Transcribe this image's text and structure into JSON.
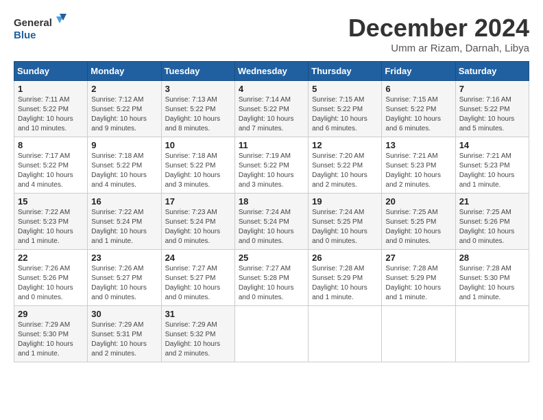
{
  "header": {
    "logo_line1": "General",
    "logo_line2": "Blue",
    "month": "December 2024",
    "location": "Umm ar Rizam, Darnah, Libya"
  },
  "weekdays": [
    "Sunday",
    "Monday",
    "Tuesday",
    "Wednesday",
    "Thursday",
    "Friday",
    "Saturday"
  ],
  "weeks": [
    [
      {
        "day": "1",
        "sunrise": "7:11 AM",
        "sunset": "5:22 PM",
        "daylight": "10 hours and 10 minutes."
      },
      {
        "day": "2",
        "sunrise": "7:12 AM",
        "sunset": "5:22 PM",
        "daylight": "10 hours and 9 minutes."
      },
      {
        "day": "3",
        "sunrise": "7:13 AM",
        "sunset": "5:22 PM",
        "daylight": "10 hours and 8 minutes."
      },
      {
        "day": "4",
        "sunrise": "7:14 AM",
        "sunset": "5:22 PM",
        "daylight": "10 hours and 7 minutes."
      },
      {
        "day": "5",
        "sunrise": "7:15 AM",
        "sunset": "5:22 PM",
        "daylight": "10 hours and 6 minutes."
      },
      {
        "day": "6",
        "sunrise": "7:15 AM",
        "sunset": "5:22 PM",
        "daylight": "10 hours and 6 minutes."
      },
      {
        "day": "7",
        "sunrise": "7:16 AM",
        "sunset": "5:22 PM",
        "daylight": "10 hours and 5 minutes."
      }
    ],
    [
      {
        "day": "8",
        "sunrise": "7:17 AM",
        "sunset": "5:22 PM",
        "daylight": "10 hours and 4 minutes."
      },
      {
        "day": "9",
        "sunrise": "7:18 AM",
        "sunset": "5:22 PM",
        "daylight": "10 hours and 4 minutes."
      },
      {
        "day": "10",
        "sunrise": "7:18 AM",
        "sunset": "5:22 PM",
        "daylight": "10 hours and 3 minutes."
      },
      {
        "day": "11",
        "sunrise": "7:19 AM",
        "sunset": "5:22 PM",
        "daylight": "10 hours and 3 minutes."
      },
      {
        "day": "12",
        "sunrise": "7:20 AM",
        "sunset": "5:22 PM",
        "daylight": "10 hours and 2 minutes."
      },
      {
        "day": "13",
        "sunrise": "7:21 AM",
        "sunset": "5:23 PM",
        "daylight": "10 hours and 2 minutes."
      },
      {
        "day": "14",
        "sunrise": "7:21 AM",
        "sunset": "5:23 PM",
        "daylight": "10 hours and 1 minute."
      }
    ],
    [
      {
        "day": "15",
        "sunrise": "7:22 AM",
        "sunset": "5:23 PM",
        "daylight": "10 hours and 1 minute."
      },
      {
        "day": "16",
        "sunrise": "7:22 AM",
        "sunset": "5:24 PM",
        "daylight": "10 hours and 1 minute."
      },
      {
        "day": "17",
        "sunrise": "7:23 AM",
        "sunset": "5:24 PM",
        "daylight": "10 hours and 0 minutes."
      },
      {
        "day": "18",
        "sunrise": "7:24 AM",
        "sunset": "5:24 PM",
        "daylight": "10 hours and 0 minutes."
      },
      {
        "day": "19",
        "sunrise": "7:24 AM",
        "sunset": "5:25 PM",
        "daylight": "10 hours and 0 minutes."
      },
      {
        "day": "20",
        "sunrise": "7:25 AM",
        "sunset": "5:25 PM",
        "daylight": "10 hours and 0 minutes."
      },
      {
        "day": "21",
        "sunrise": "7:25 AM",
        "sunset": "5:26 PM",
        "daylight": "10 hours and 0 minutes."
      }
    ],
    [
      {
        "day": "22",
        "sunrise": "7:26 AM",
        "sunset": "5:26 PM",
        "daylight": "10 hours and 0 minutes."
      },
      {
        "day": "23",
        "sunrise": "7:26 AM",
        "sunset": "5:27 PM",
        "daylight": "10 hours and 0 minutes."
      },
      {
        "day": "24",
        "sunrise": "7:27 AM",
        "sunset": "5:27 PM",
        "daylight": "10 hours and 0 minutes."
      },
      {
        "day": "25",
        "sunrise": "7:27 AM",
        "sunset": "5:28 PM",
        "daylight": "10 hours and 0 minutes."
      },
      {
        "day": "26",
        "sunrise": "7:28 AM",
        "sunset": "5:29 PM",
        "daylight": "10 hours and 1 minute."
      },
      {
        "day": "27",
        "sunrise": "7:28 AM",
        "sunset": "5:29 PM",
        "daylight": "10 hours and 1 minute."
      },
      {
        "day": "28",
        "sunrise": "7:28 AM",
        "sunset": "5:30 PM",
        "daylight": "10 hours and 1 minute."
      }
    ],
    [
      {
        "day": "29",
        "sunrise": "7:29 AM",
        "sunset": "5:30 PM",
        "daylight": "10 hours and 1 minute."
      },
      {
        "day": "30",
        "sunrise": "7:29 AM",
        "sunset": "5:31 PM",
        "daylight": "10 hours and 2 minutes."
      },
      {
        "day": "31",
        "sunrise": "7:29 AM",
        "sunset": "5:32 PM",
        "daylight": "10 hours and 2 minutes."
      },
      null,
      null,
      null,
      null
    ]
  ],
  "labels": {
    "sunrise": "Sunrise:",
    "sunset": "Sunset:",
    "daylight": "Daylight:"
  }
}
